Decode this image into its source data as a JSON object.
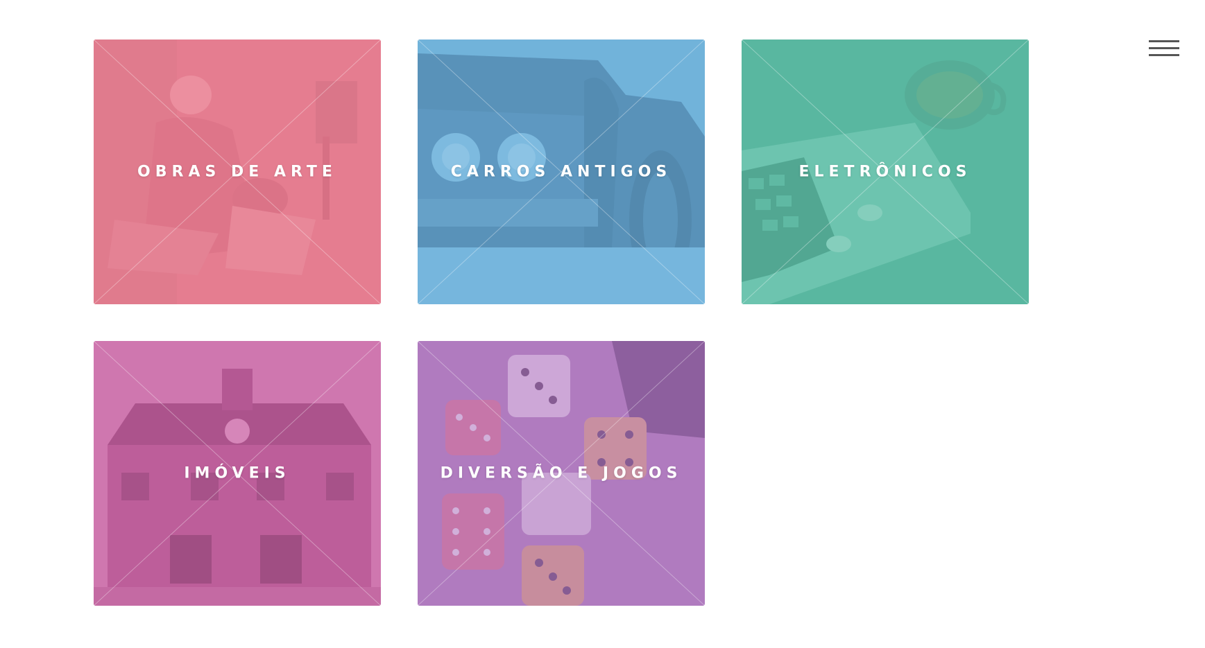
{
  "menu": {
    "icon": "hamburger-menu-icon"
  },
  "tiles": [
    {
      "label": "OBRAS DE ARTE",
      "color": "#e9798f",
      "image": "painting-photo"
    },
    {
      "label": "CARROS ANTIGOS",
      "color": "#6bb0dc",
      "image": "classic-car-photo"
    },
    {
      "label": "ELETRÔNICOS",
      "color": "#5fbfa8",
      "image": "laptop-coffee-photo"
    },
    {
      "label": "IMÓVEIS",
      "color": "#cc6aaa",
      "image": "house-photo"
    },
    {
      "label": "DIVERSÃO E JOGOS",
      "color": "#b57fc4",
      "image": "dice-game-photo"
    }
  ]
}
